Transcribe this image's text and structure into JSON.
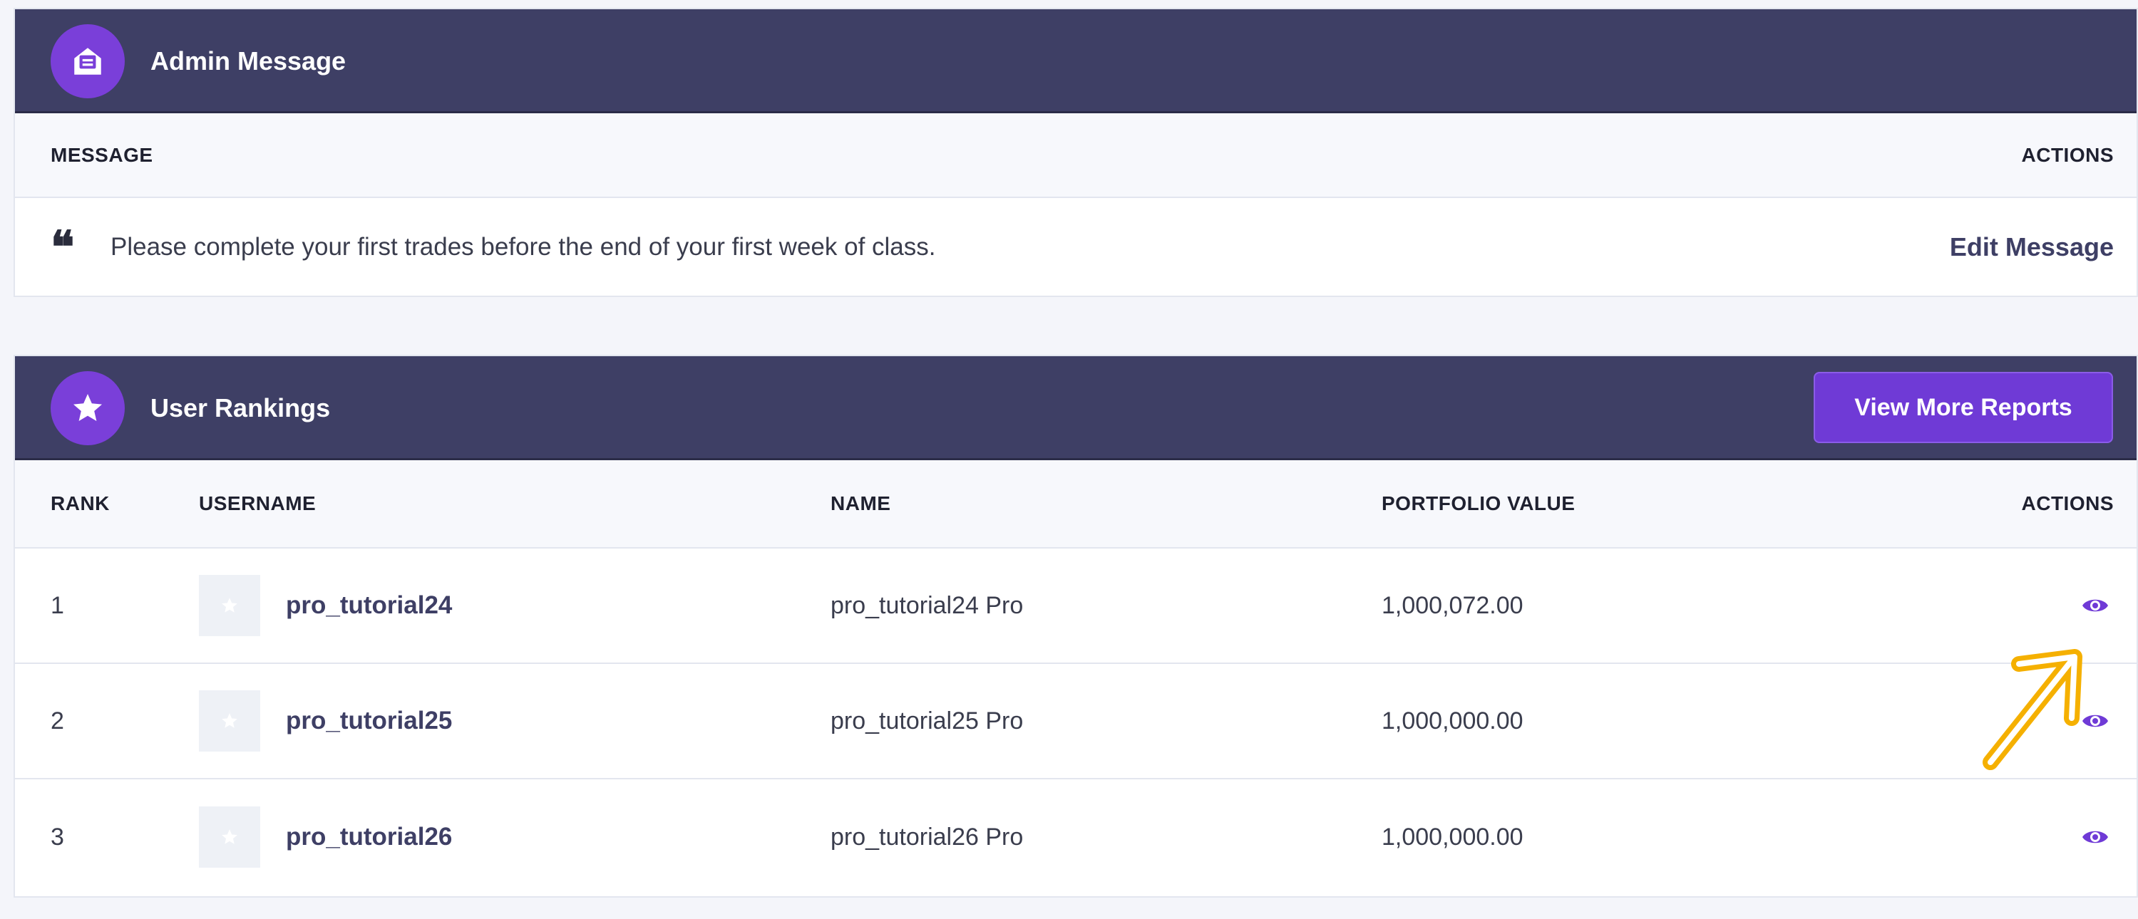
{
  "admin": {
    "title": "Admin Message",
    "icon": "envelope-open-text-icon",
    "columns": {
      "message": "MESSAGE",
      "actions": "ACTIONS"
    },
    "message_text": "Please complete your first trades before the end of your first week of class.",
    "quote_glyph": "❝",
    "edit_label": "Edit Message"
  },
  "rankings": {
    "title": "User Rankings",
    "icon": "star-icon",
    "view_more_label": "View More Reports",
    "columns": {
      "rank": "RANK",
      "username": "USERNAME",
      "name": "NAME",
      "portfolio_value": "PORTFOLIO VALUE",
      "actions": "ACTIONS"
    },
    "rows": [
      {
        "rank": "1",
        "username": "pro_tutorial24",
        "name": "pro_tutorial24 Pro",
        "portfolio_value": "1,000,072.00",
        "action_icon": "eye-icon"
      },
      {
        "rank": "2",
        "username": "pro_tutorial25",
        "name": "pro_tutorial25 Pro",
        "portfolio_value": "1,000,000.00",
        "action_icon": "eye-icon"
      },
      {
        "rank": "3",
        "username": "pro_tutorial26",
        "name": "pro_tutorial26 Pro",
        "portfolio_value": "1,000,000.00",
        "action_icon": "eye-icon"
      }
    ]
  },
  "colors": {
    "header_bg": "#3e3f65",
    "accent_purple": "#7a3fd9",
    "button_purple": "#6f3ad6",
    "eye_icon": "#6f3ad6",
    "annotation_arrow": "#f5b000"
  }
}
